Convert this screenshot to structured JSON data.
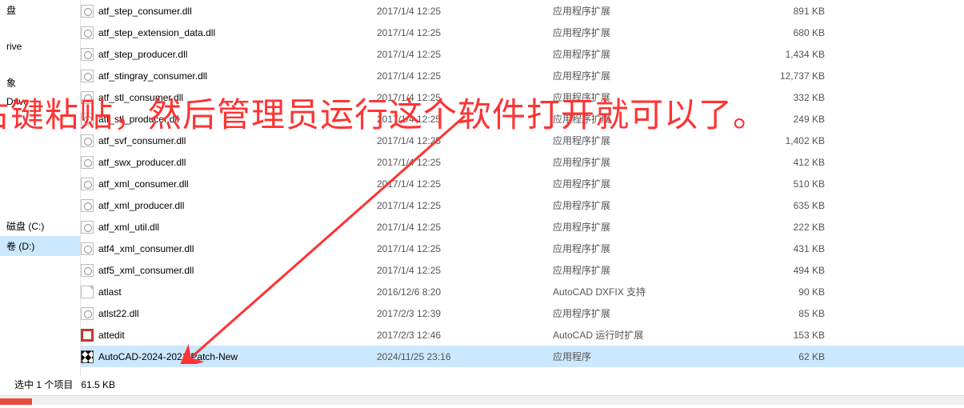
{
  "sidebar": {
    "items": [
      {
        "label": "盘"
      },
      {
        "label": " "
      },
      {
        "label": "rive"
      },
      {
        "label": " "
      },
      {
        "label": "象"
      },
      {
        "label": "Drive"
      },
      {
        "label": " "
      },
      {
        "label": " "
      },
      {
        "label": " "
      },
      {
        "label": " "
      },
      {
        "label": " "
      },
      {
        "label": " "
      },
      {
        "label": "磁盘 (C:)"
      },
      {
        "label": "卷 (D:)",
        "selected": true
      }
    ]
  },
  "files": [
    {
      "icon": "dll",
      "name": "atf_step_consumer.dll",
      "date": "2017/1/4 12:25",
      "type": "应用程序扩展",
      "size": "891 KB"
    },
    {
      "icon": "dll",
      "name": "atf_step_extension_data.dll",
      "date": "2017/1/4 12:25",
      "type": "应用程序扩展",
      "size": "680 KB"
    },
    {
      "icon": "dll",
      "name": "atf_step_producer.dll",
      "date": "2017/1/4 12:25",
      "type": "应用程序扩展",
      "size": "1,434 KB"
    },
    {
      "icon": "dll",
      "name": "atf_stingray_consumer.dll",
      "date": "2017/1/4 12:25",
      "type": "应用程序扩展",
      "size": "12,737 KB"
    },
    {
      "icon": "dll",
      "name": "atf_stl_consumer.dll",
      "date": "2017/1/4 12:25",
      "type": "应用程序扩展",
      "size": "332 KB"
    },
    {
      "icon": "dll",
      "name": "atf_stl_producer.dll",
      "date": "2017/1/4 12:25",
      "type": "应用程序扩展",
      "size": "249 KB"
    },
    {
      "icon": "dll",
      "name": "atf_svf_consumer.dll",
      "date": "2017/1/4 12:25",
      "type": "应用程序扩展",
      "size": "1,402 KB"
    },
    {
      "icon": "dll",
      "name": "atf_swx_producer.dll",
      "date": "2017/1/4 12:25",
      "type": "应用程序扩展",
      "size": "412 KB"
    },
    {
      "icon": "dll",
      "name": "atf_xml_consumer.dll",
      "date": "2017/1/4 12:25",
      "type": "应用程序扩展",
      "size": "510 KB"
    },
    {
      "icon": "dll",
      "name": "atf_xml_producer.dll",
      "date": "2017/1/4 12:25",
      "type": "应用程序扩展",
      "size": "635 KB"
    },
    {
      "icon": "dll",
      "name": "atf_xml_util.dll",
      "date": "2017/1/4 12:25",
      "type": "应用程序扩展",
      "size": "222 KB"
    },
    {
      "icon": "dll",
      "name": "atf4_xml_consumer.dll",
      "date": "2017/1/4 12:25",
      "type": "应用程序扩展",
      "size": "431 KB"
    },
    {
      "icon": "dll",
      "name": "atf5_xml_consumer.dll",
      "date": "2017/1/4 12:25",
      "type": "应用程序扩展",
      "size": "494 KB"
    },
    {
      "icon": "page",
      "name": "atlast",
      "date": "2016/12/6 8:20",
      "type": "AutoCAD DXFIX 支持",
      "size": "90 KB"
    },
    {
      "icon": "dll",
      "name": "atlst22.dll",
      "date": "2017/2/3 12:39",
      "type": "应用程序扩展",
      "size": "85 KB"
    },
    {
      "icon": "red",
      "name": "attedit",
      "date": "2017/2/3 12:46",
      "type": "AutoCAD 运行时扩展",
      "size": "153 KB"
    },
    {
      "icon": "patch",
      "name": "AutoCAD-2024-2021-Patch-New",
      "date": "2024/11/25 23:16",
      "type": "应用程序",
      "size": "62 KB",
      "selected": true
    }
  ],
  "status": {
    "text": "选中 1 个项目",
    "size": "61.5 KB"
  },
  "annotation": {
    "text": "右键粘贴，然后管理员运行这个软件打开就可以了。"
  }
}
